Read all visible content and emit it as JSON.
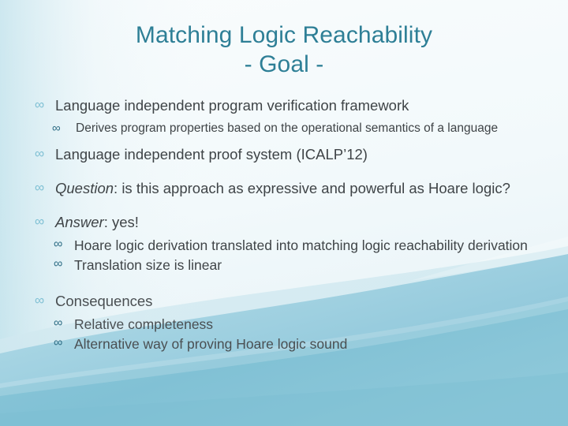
{
  "slide": {
    "title": {
      "line1": "Matching Logic Reachability",
      "line2": "- Goal -"
    },
    "bullet_glyph": "∞",
    "colors": {
      "title": "#2E7F96",
      "body_text": "#3F4447",
      "bullet_level1": "#7FC0D4",
      "bullet_level2": "#2F6E86",
      "background_top": "#F7FAFC",
      "background_wave": "#8DC6D8",
      "background_wave_deep": "#7BBED2"
    },
    "content": [
      {
        "level": 1,
        "text": "Language independent program verification framework"
      },
      {
        "level": 2,
        "text": "Derives program properties based on the operational semantics of a language"
      },
      {
        "level": 1,
        "text": "Language independent proof system (ICALP’12)"
      },
      {
        "level": 1,
        "emphasis": "Question",
        "text": ": is this approach as expressive and powerful as Hoare logic?",
        "justified": true
      },
      {
        "level": 1,
        "emphasis": "Answer",
        "text": ": yes!"
      },
      {
        "level": 2,
        "text": "Hoare logic derivation translated into matching logic reachability derivation",
        "justified": true
      },
      {
        "level": 2,
        "text": "Translation size is linear"
      },
      {
        "level": 1,
        "text": "Consequences"
      },
      {
        "level": 2,
        "text": "Relative completeness"
      },
      {
        "level": 2,
        "text": "Alternative way of proving Hoare logic sound"
      }
    ]
  }
}
